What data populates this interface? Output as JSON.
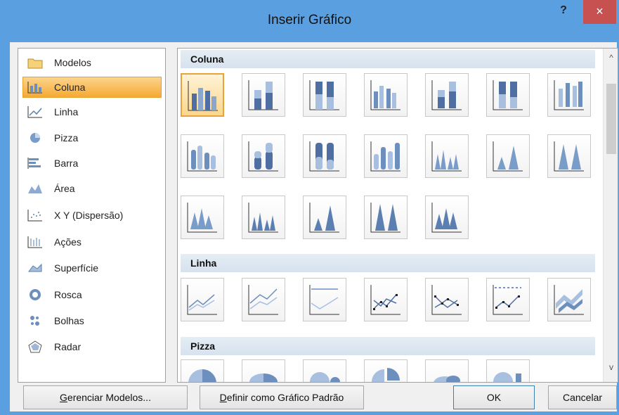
{
  "window": {
    "title": "Inserir Gráfico",
    "help": "?",
    "close": "×"
  },
  "categories": [
    {
      "label": "Modelos",
      "icon": "folder-icon"
    },
    {
      "label": "Coluna",
      "icon": "column-chart-icon",
      "selected": true
    },
    {
      "label": "Linha",
      "icon": "line-chart-icon"
    },
    {
      "label": "Pizza",
      "icon": "pie-chart-icon"
    },
    {
      "label": "Barra",
      "icon": "bar-chart-icon"
    },
    {
      "label": "Área",
      "icon": "area-chart-icon"
    },
    {
      "label": "X Y (Dispersão)",
      "icon": "scatter-chart-icon"
    },
    {
      "label": "Ações",
      "icon": "stock-chart-icon"
    },
    {
      "label": "Superfície",
      "icon": "surface-chart-icon"
    },
    {
      "label": "Rosca",
      "icon": "doughnut-chart-icon"
    },
    {
      "label": "Bolhas",
      "icon": "bubble-chart-icon"
    },
    {
      "label": "Radar",
      "icon": "radar-chart-icon"
    }
  ],
  "sections": [
    {
      "title": "Coluna"
    },
    {
      "title": "Linha"
    },
    {
      "title": "Pizza"
    }
  ],
  "buttons": {
    "manage_pre": "G",
    "manage_rest": "erenciar Modelos...",
    "default_pre": "D",
    "default_rest": "efinir como Gráfico Padrão",
    "ok": "OK",
    "cancel": "Cancelar"
  },
  "scroll": {
    "up": "^",
    "down": "v"
  }
}
